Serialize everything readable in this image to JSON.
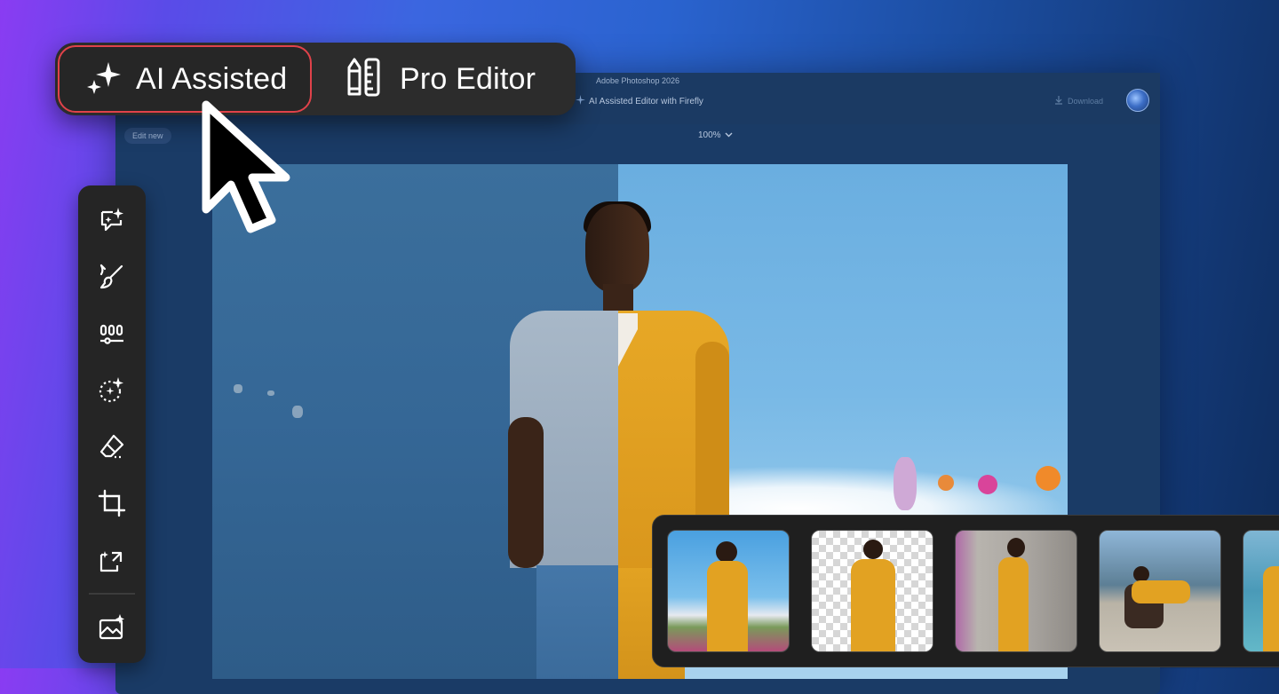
{
  "mode_switcher": {
    "ai_assisted_label": "AI Assisted",
    "pro_editor_label": "Pro Editor",
    "selected": "AI Assisted"
  },
  "app_window": {
    "title": "Adobe Photoshop 2026",
    "subtitle": "AI Assisted Editor with Firefly",
    "download_label": "Download",
    "edit_new_label": "Edit new",
    "zoom_label": "100%"
  },
  "tools": [
    {
      "icon": "chat-sparkle-icon"
    },
    {
      "icon": "brush-icon"
    },
    {
      "icon": "adjust-sliders-icon"
    },
    {
      "icon": "select-sparkle-icon"
    },
    {
      "icon": "eraser-icon"
    },
    {
      "icon": "crop-icon"
    },
    {
      "icon": "expand-icon"
    },
    {
      "icon": "generate-image-icon"
    }
  ],
  "variants": [
    {
      "name": "flower-field"
    },
    {
      "name": "transparent-background"
    },
    {
      "name": "concrete-room"
    },
    {
      "name": "lounge-chair"
    },
    {
      "name": "pool"
    }
  ],
  "colors": {
    "accent_red": "#e0424a",
    "panel_dark": "#2c2c2c",
    "suit_yellow": "#e2a222"
  }
}
